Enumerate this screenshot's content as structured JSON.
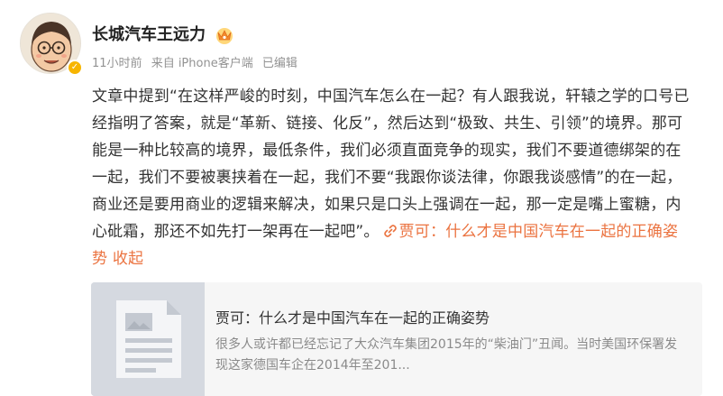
{
  "author": {
    "name": "长城汽车王远力",
    "avatar": "cartoon-face-avatar",
    "badge": "verified-badge",
    "level_icon": "crown-icon"
  },
  "meta": {
    "time": "11小时前",
    "source": "来自 iPhone客户端",
    "edited": "已编辑"
  },
  "post": {
    "body": "文章中提到“在这样严峻的时刻，中国汽车怎么在一起？有人跟我说，轩辕之学的口号已经指明了答案，就是“革新、链接、化反”，然后达到“极致、共生、引领”的境界。那可能是一种比较高的境界，最低条件，我们必须直面竞争的现实，我们不要道德绑架的在一起，我们不要被裹挟着在一起，我们不要“我跟你谈法律，你跟我谈感情”的在一起，商业还是要用商业的逻辑来解决，如果只是口头上强调在一起，那一定是嘴上蜜糖，内心砒霜，那还不如先打一架再在一起吧”。",
    "link_text": "贾可：什么才是中国汽车在一起的正确姿势",
    "collapse_text": "收起",
    "link_color": "#eb7340"
  },
  "card": {
    "title": "贾可：什么才是中国汽车在一起的正确姿势",
    "description": "很多人或许都已经忘记了大众汽车集团2015年的“柴油门”丑闻。当时美国环保署发现这家德国车企在2014年至201..."
  }
}
